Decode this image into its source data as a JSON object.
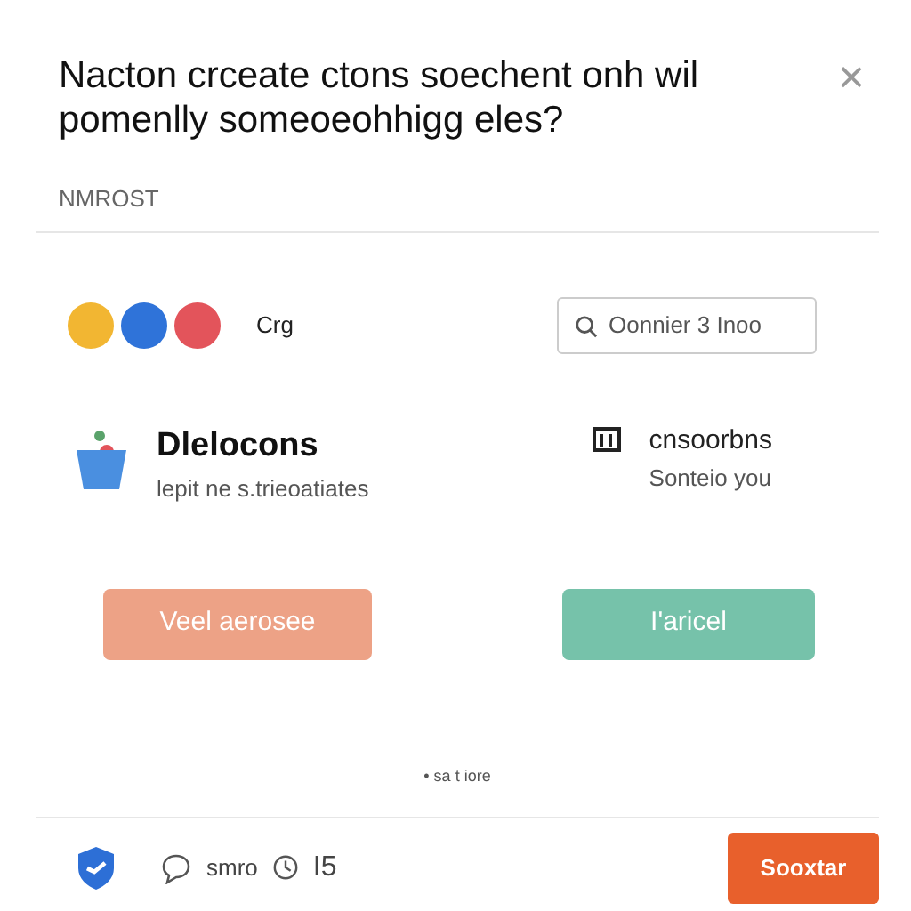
{
  "dialog": {
    "title": "Nacton crceate ctons soechent onh wil pomenlly someoeohhigg eles?",
    "close": "×",
    "section_label": "NMROST"
  },
  "app_row": {
    "apps": [
      {
        "color": "#f2b632"
      },
      {
        "color": "#2f73d9"
      },
      {
        "color": "#e3545b"
      }
    ],
    "label": "Crg",
    "search": {
      "placeholder": "Oonnier 3 Inoo"
    }
  },
  "items": [
    {
      "title": "Dlelocons",
      "subtitle": "lepit ne s.trieoatiates",
      "emphasis": true
    },
    {
      "title": "cnsoorbns",
      "subtitle": "Sonteio you",
      "emphasis": false
    }
  ],
  "buttons": [
    {
      "label": "Veel aerosee",
      "color": "#eda286"
    },
    {
      "label": "I'aricel",
      "color": "#76c2aa"
    }
  ],
  "note": "• sa t iore",
  "footer": {
    "comment": "smro",
    "count": "I5",
    "action": "Sooxtar"
  }
}
